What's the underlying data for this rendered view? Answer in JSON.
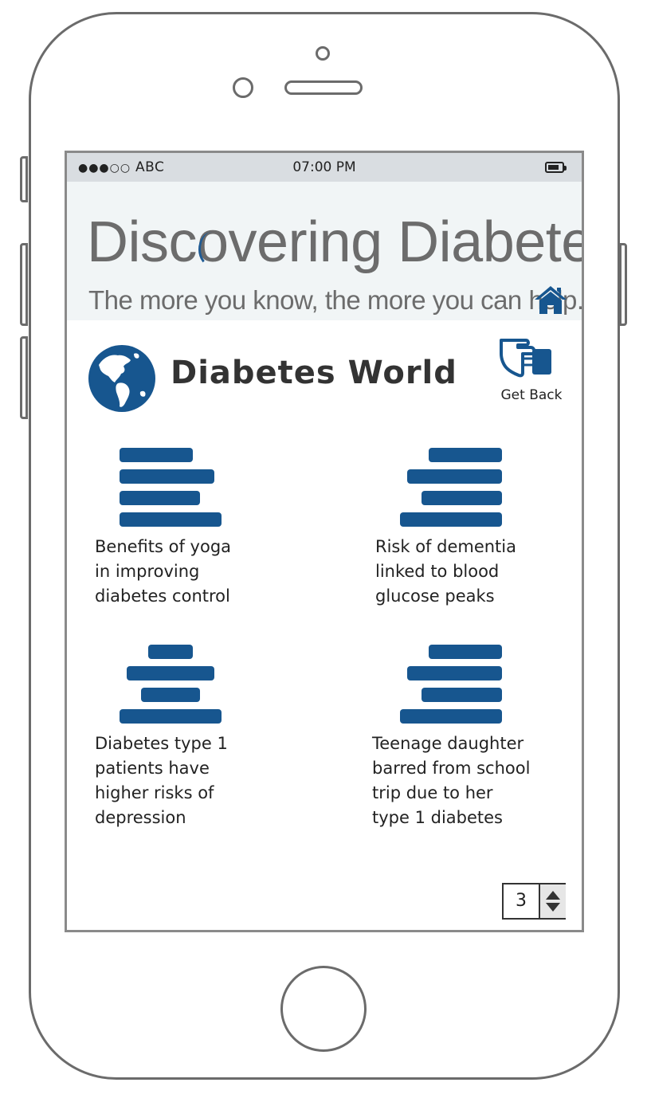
{
  "status_bar": {
    "signal": "●●●○○",
    "carrier": "ABC",
    "time": "07:00 PM",
    "battery_icon": "battery-icon"
  },
  "banner": {
    "title_before": "Disc",
    "title_o": "o",
    "title_after": "vering Diabetes",
    "tagline": "The more you know, the more you can help.",
    "home_icon": "home-icon"
  },
  "section": {
    "title": "Diabetes World",
    "icon": "globe-icon"
  },
  "get_back": {
    "label": "Get Back",
    "icon": "pointing-hand-icon"
  },
  "articles": [
    {
      "lines": [
        "Benefits of yoga",
        "in improving",
        "diabetes control"
      ],
      "icon": "align-left-icon"
    },
    {
      "lines": [
        "Risk of dementia",
        "linked to blood",
        "glucose peaks"
      ],
      "icon": "align-right-icon"
    },
    {
      "lines": [
        "Diabetes type 1",
        "patients have",
        "higher risks of",
        "depression"
      ],
      "icon": "align-center-icon"
    },
    {
      "lines": [
        "Teenage daughter",
        "barred from school",
        "trip due to her",
        "type 1 diabetes"
      ],
      "icon": "align-right-icon"
    }
  ],
  "pager": {
    "value": "3"
  },
  "colors": {
    "accent": "#17568f",
    "banner_bg": "#f1f5f6",
    "status_bg": "#d9dde1"
  }
}
